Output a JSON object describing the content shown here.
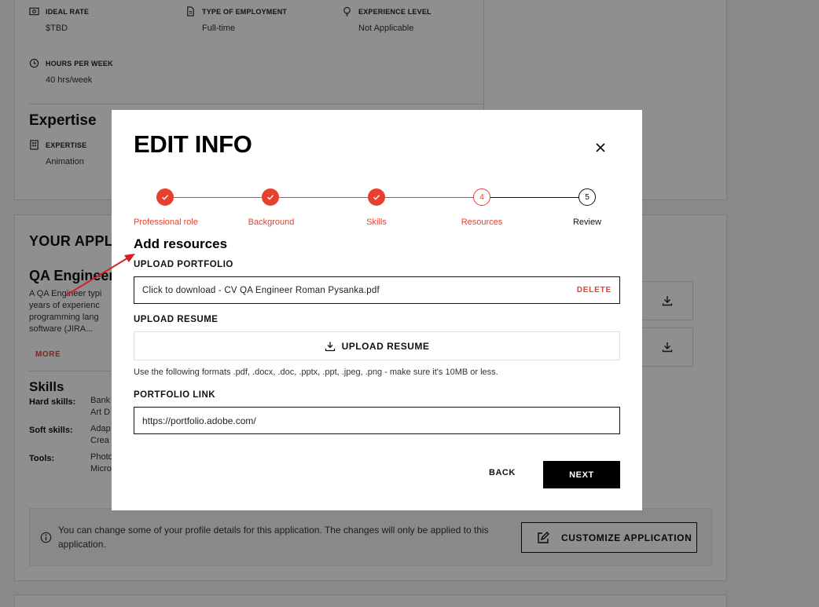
{
  "background": {
    "details": {
      "ideal_rate": {
        "label": "IDEAL RATE",
        "value": "$TBD",
        "icon": "money-icon"
      },
      "employment": {
        "label": "TYPE OF EMPLOYMENT",
        "value": "Full-time",
        "icon": "document-icon"
      },
      "experience": {
        "label": "EXPERIENCE LEVEL",
        "value": "Not Applicable",
        "icon": "lightbulb-icon"
      },
      "hours": {
        "label": "HOURS PER WEEK",
        "value": "40 hrs/week",
        "icon": "clock-icon"
      }
    },
    "expertise": {
      "title": "Expertise",
      "label": "EXPERTISE",
      "value": "Animation",
      "icon": "building-icon"
    },
    "application": {
      "title": "YOUR APPL",
      "role": "QA Engineer",
      "description_lines": [
        "A QA Engineer typi",
        "years of experienc",
        "programming lang",
        "software (JIRA..."
      ],
      "more_label": "MORE"
    },
    "skills": {
      "title": "Skills",
      "hard_label": "Hard skills:",
      "hard_lines": [
        "Bank",
        "Art D"
      ],
      "soft_label": "Soft skills:",
      "soft_lines": [
        "Adap",
        "Crea"
      ],
      "tools_label": "Tools:",
      "tools_lines": [
        "Photo",
        "Micro"
      ]
    },
    "notice": {
      "text": "You can change some of your profile details for this application. The changes will only be applied to this application.",
      "button_label": "CUSTOMIZE APPLICATION"
    }
  },
  "modal": {
    "title": "EDIT INFO",
    "steps": [
      {
        "label": "Professional role",
        "state": "done"
      },
      {
        "label": "Background",
        "state": "done"
      },
      {
        "label": "Skills",
        "state": "done"
      },
      {
        "label": "Resources",
        "state": "current",
        "number": "4"
      },
      {
        "label": "Review",
        "state": "todo",
        "number": "5"
      }
    ],
    "section_title": "Add resources",
    "portfolio": {
      "label": "UPLOAD PORTFOLIO",
      "file_text": "Click to download - CV QA Engineer Roman Pysanka.pdf",
      "delete_label": "DELETE"
    },
    "resume": {
      "label": "UPLOAD RESUME",
      "button_label": "UPLOAD RESUME",
      "hint": "Use the following formats .pdf, .docx, .doc, .pptx, .ppt, .jpeg, .png - make sure it's 10MB or less."
    },
    "portfolio_link": {
      "label": "PORTFOLIO LINK",
      "value": "https://portfolio.adobe.com/"
    },
    "back_label": "BACK",
    "next_label": "NEXT"
  },
  "colors": {
    "accent": "#e8402f",
    "annotation_arrow": "#d42020",
    "overlay": "rgba(0,0,0,0.44)"
  }
}
